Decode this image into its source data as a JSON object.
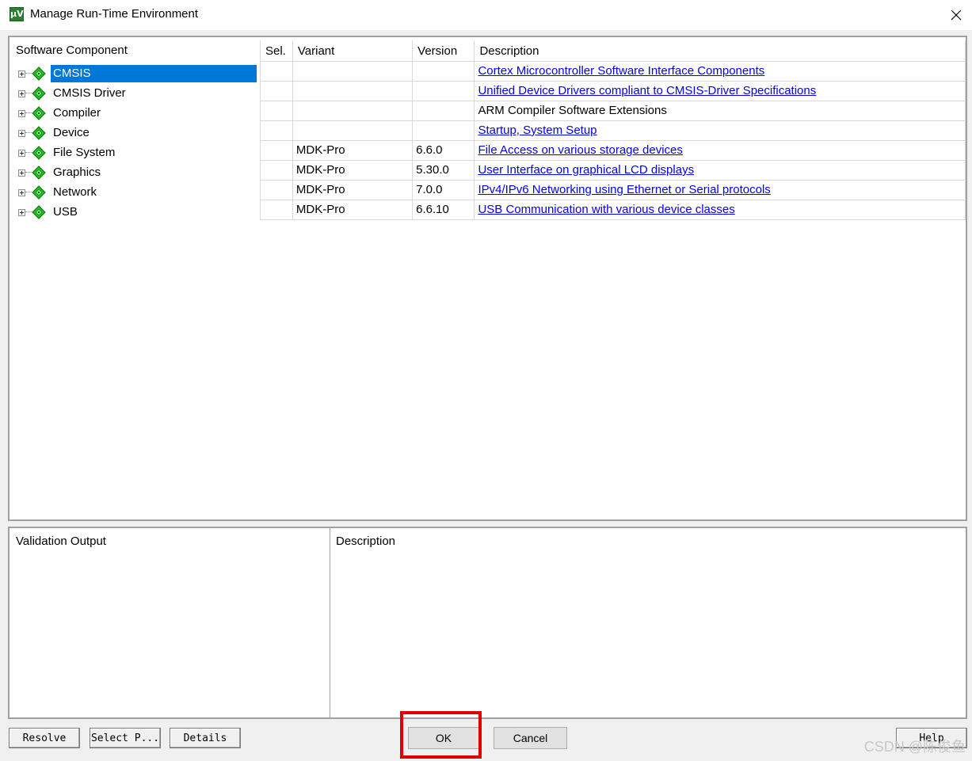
{
  "window": {
    "title": "Manage Run-Time Environment",
    "icon_text": "μV"
  },
  "components": {
    "header": "Software Component",
    "columns": {
      "sel": "Sel.",
      "variant": "Variant",
      "version": "Version",
      "description": "Description"
    },
    "rows": [
      {
        "name": "CMSIS",
        "variant": "",
        "version": "",
        "description": "Cortex Microcontroller Software Interface Components",
        "is_link": true,
        "selected": true
      },
      {
        "name": "CMSIS Driver",
        "variant": "",
        "version": "",
        "description": "Unified Device Drivers compliant to CMSIS-Driver Specifications",
        "is_link": true
      },
      {
        "name": "Compiler",
        "variant": "",
        "version": "",
        "description": "ARM Compiler Software Extensions",
        "is_link": false
      },
      {
        "name": "Device",
        "variant": "",
        "version": "",
        "description": "Startup, System Setup",
        "is_link": true
      },
      {
        "name": "File System",
        "variant": "MDK-Pro",
        "version": "6.6.0",
        "description": "File Access on various storage devices",
        "is_link": true
      },
      {
        "name": "Graphics",
        "variant": "MDK-Pro",
        "version": "5.30.0",
        "description": "User Interface on graphical LCD displays",
        "is_link": true
      },
      {
        "name": "Network",
        "variant": "MDK-Pro",
        "version": "7.0.0",
        "description": "IPv4/IPv6 Networking using Ethernet or Serial protocols",
        "is_link": true
      },
      {
        "name": "USB",
        "variant": "MDK-Pro",
        "version": "6.6.10",
        "description": "USB Communication with various device classes",
        "is_link": true
      }
    ]
  },
  "validation": {
    "output_header": "Validation Output",
    "description_header": "Description"
  },
  "buttons": {
    "resolve": "Resolve",
    "select_packs": "Select P...",
    "details": "Details",
    "ok": "OK",
    "cancel": "Cancel",
    "help": "Help"
  },
  "watermark": "CSDN @陈俊鱼",
  "colors": {
    "selection": "#0078d7",
    "link": "#0000ee",
    "component_icon": "#22c322",
    "highlight_box": "#e00000"
  }
}
